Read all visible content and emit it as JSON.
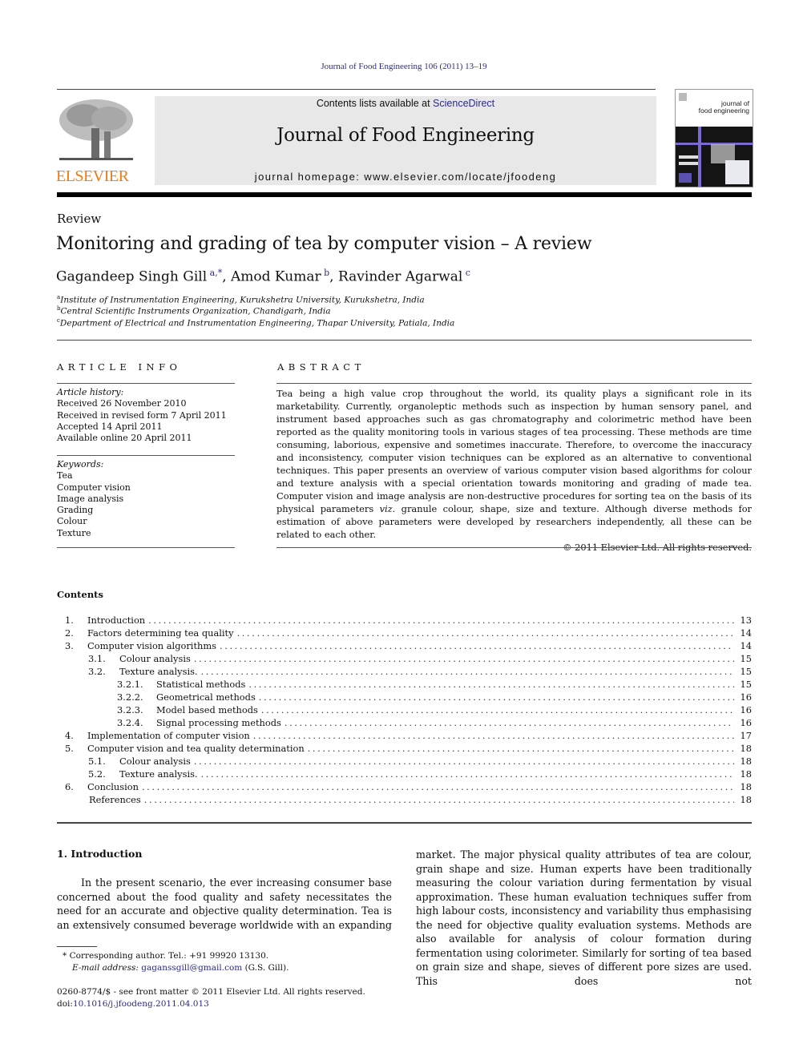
{
  "header": {
    "citation": "Journal of Food Engineering 106 (2011) 13–19",
    "contents_prefix": "Contents lists available at ",
    "contents_link": "ScienceDirect",
    "journal_title": "Journal of Food Engineering",
    "homepage_prefix": "journal homepage: ",
    "homepage_url": "www.elsevier.com/locate/jfoodeng",
    "publisher_wordmark": "ELSEVIER",
    "cover_title_line1": "journal of",
    "cover_title_line2": "food engineering"
  },
  "article": {
    "type": "Review",
    "title": "Monitoring and grading of tea by computer vision – A review",
    "authors": [
      {
        "name": "Gagandeep Singh Gill",
        "sup": "a,*"
      },
      {
        "name": "Amod Kumar",
        "sup": "b"
      },
      {
        "name": "Ravinder Agarwal",
        "sup": "c"
      }
    ],
    "affiliations": [
      {
        "mark": "a",
        "text": "Institute of Instrumentation Engineering, Kurukshetra University, Kurukshetra, India"
      },
      {
        "mark": "b",
        "text": "Central Scientific Instruments Organization, Chandigarh, India"
      },
      {
        "mark": "c",
        "text": "Department of Electrical and Instrumentation Engineering, Thapar University, Patiala, India"
      }
    ]
  },
  "article_info": {
    "heading": "ARTICLE INFO",
    "history_label": "Article history:",
    "history": [
      "Received 26 November 2010",
      "Received in revised form 7 April 2011",
      "Accepted 14 April 2011",
      "Available online 20 April 2011"
    ],
    "keywords_label": "Keywords:",
    "keywords": [
      "Tea",
      "Computer vision",
      "Image analysis",
      "Grading",
      "Colour",
      "Texture"
    ]
  },
  "abstract": {
    "heading": "ABSTRACT",
    "text_before_viz": "Tea being a high value crop throughout the world, its quality plays a significant role in its marketability. Currently, organoleptic methods such as inspection by human sensory panel, and instrument based approaches such as gas chromatography and colorimetric method have been reported as the quality monitoring tools in various stages of tea processing. These methods are time consuming, laborious, expensive and sometimes inaccurate. Therefore, to overcome the inaccuracy and inconsistency, computer vision techniques can be explored as an alternative to conventional techniques. This paper presents an overview of various computer vision based algorithms for colour and texture analysis with a special orientation towards monitoring and grading of made tea. Computer vision and image analysis are non-destructive procedures for sorting tea on the basis of its physical parameters ",
    "viz": "viz.",
    "text_after_viz": " granule colour, shape, size and texture. Although diverse methods for estimation of above parameters were developed by researchers independently, all these can be related to each other.",
    "copyright": "© 2011 Elsevier Ltd. All rights reserved."
  },
  "contents": {
    "heading": "Contents",
    "items": [
      {
        "num": "1.",
        "title": "Introduction",
        "page": "13",
        "level": 1
      },
      {
        "num": "2.",
        "title": "Factors determining tea quality",
        "page": "14",
        "level": 1
      },
      {
        "num": "3.",
        "title": "Computer vision algorithms",
        "page": "14",
        "level": 1
      },
      {
        "num": "3.1.",
        "title": "Colour analysis",
        "page": "15",
        "level": 2
      },
      {
        "num": "3.2.",
        "title": "Texture analysis.",
        "page": "15",
        "level": 2
      },
      {
        "num": "3.2.1.",
        "title": "Statistical methods",
        "page": "15",
        "level": 3
      },
      {
        "num": "3.2.2.",
        "title": "Geometrical methods",
        "page": "16",
        "level": 3
      },
      {
        "num": "3.2.3.",
        "title": "Model based methods",
        "page": "16",
        "level": 3
      },
      {
        "num": "3.2.4.",
        "title": "Signal processing methods",
        "page": "16",
        "level": 3
      },
      {
        "num": "4.",
        "title": "Implementation of computer vision",
        "page": "17",
        "level": 1
      },
      {
        "num": "5.",
        "title": "Computer vision and tea quality determination",
        "page": "18",
        "level": 1
      },
      {
        "num": "5.1.",
        "title": "Colour analysis",
        "page": "18",
        "level": 2
      },
      {
        "num": "5.2.",
        "title": "Texture analysis.",
        "page": "18",
        "level": 2
      },
      {
        "num": "6.",
        "title": "Conclusion",
        "page": "18",
        "level": 1
      },
      {
        "num": "",
        "title": "References",
        "page": "18",
        "level": 0
      }
    ]
  },
  "introduction": {
    "heading": "1. Introduction",
    "left_text": "In the present scenario, the ever increasing consumer base concerned about the food quality and safety necessitates the need for an accurate and objective quality determination. Tea is an extensively consumed beverage worldwide with an expanding",
    "right_text": "market. The major physical quality attributes of tea are colour, grain shape and size. Human experts have been traditionally measuring the colour variation during fermentation by visual approximation. These human evaluation techniques suffer from high labour costs, inconsistency and variability thus emphasising the need for objective quality evaluation systems. Methods are also available for analysis of colour formation during fermentation using colorimeter. Similarly for sorting of tea based on grain size and shape, sieves of different pore sizes are used. This does not"
  },
  "footnote": {
    "mark": "*",
    "corresponding": "Corresponding author. Tel.: +91 99920 13130.",
    "email_label": "E-mail address:",
    "email": "gaganssgill@gmail.com",
    "email_owner": " (G.S. Gill)."
  },
  "front_matter": {
    "issn_line": "0260-8774/$ - see front matter © 2011 Elsevier Ltd. All rights reserved.",
    "doi_prefix": "doi:",
    "doi": "10.1016/j.jfoodeng.2011.04.013"
  },
  "colors": {
    "link": "#2a2a8c",
    "elsevier_orange": "#f07b13",
    "banner_bg": "#e8e8e8"
  }
}
